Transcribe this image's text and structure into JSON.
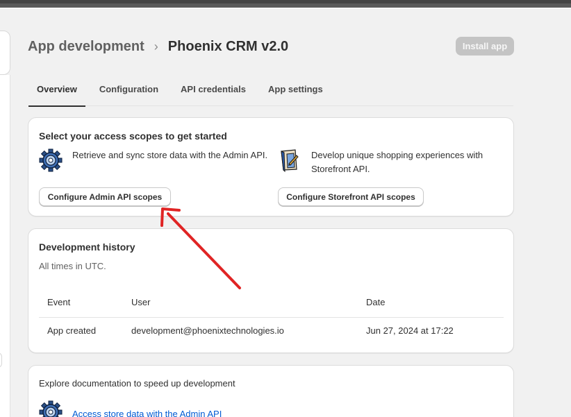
{
  "header": {
    "breadcrumb": "App development",
    "title": "Phoenix CRM v2.0",
    "install_label": "Install app"
  },
  "tabs": [
    {
      "label": "Overview",
      "active": true
    },
    {
      "label": "Configuration",
      "active": false
    },
    {
      "label": "API credentials",
      "active": false
    },
    {
      "label": "App settings",
      "active": false
    }
  ],
  "scopes_card": {
    "title": "Select your access scopes to get started",
    "admin_text": "Retrieve and sync store data with the Admin API.",
    "admin_button": "Configure Admin API scopes",
    "storefront_text": "Develop unique shopping experiences with Storefront API.",
    "storefront_button": "Configure Storefront API scopes"
  },
  "history_card": {
    "title": "Development history",
    "subtitle": "All times in UTC.",
    "columns": [
      "Event",
      "User",
      "Date"
    ],
    "rows": [
      [
        "App created",
        "development@phoenixtechnologies.io",
        "Jun 27, 2024 at 17:22"
      ]
    ]
  },
  "docs_card": {
    "text": "Explore documentation to speed up development",
    "link": "Access store data with the Admin API"
  },
  "icons": {
    "admin": "gear-icon",
    "storefront": "storefront-book-icon",
    "annotation": "red-arrow-icon"
  },
  "colors": {
    "background": "#f1f1f1",
    "link": "#005bd3",
    "annotation_arrow": "#e02424"
  }
}
